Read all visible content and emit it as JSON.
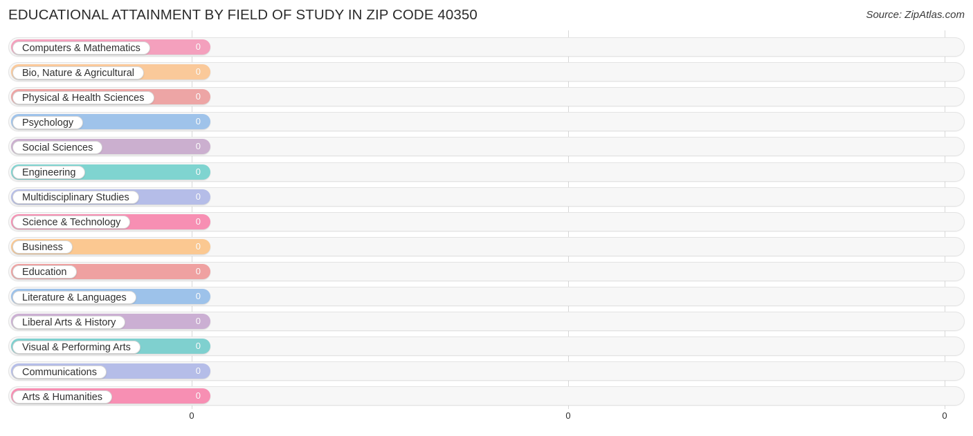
{
  "header": {
    "title": "EDUCATIONAL ATTAINMENT BY FIELD OF STUDY IN ZIP CODE 40350",
    "source": "Source: ZipAtlas.com"
  },
  "chart_data": {
    "type": "bar",
    "orientation": "horizontal",
    "title": "EDUCATIONAL ATTAINMENT BY FIELD OF STUDY IN ZIP CODE 40350",
    "xlabel": "",
    "ylabel": "",
    "xlim": [
      0,
      0
    ],
    "grid": true,
    "legend": "none",
    "xticks": [
      "0",
      "0",
      "0"
    ],
    "categories": [
      "Computers & Mathematics",
      "Bio, Nature & Agricultural",
      "Physical & Health Sciences",
      "Psychology",
      "Social Sciences",
      "Engineering",
      "Multidisciplinary Studies",
      "Science & Technology",
      "Business",
      "Education",
      "Literature & Languages",
      "Liberal Arts & History",
      "Visual & Performing Arts",
      "Communications",
      "Arts & Humanities"
    ],
    "values": [
      0,
      0,
      0,
      0,
      0,
      0,
      0,
      0,
      0,
      0,
      0,
      0,
      0,
      0,
      0
    ],
    "value_labels": [
      "0",
      "0",
      "0",
      "0",
      "0",
      "0",
      "0",
      "0",
      "0",
      "0",
      "0",
      "0",
      "0",
      "0",
      "0"
    ],
    "colors": [
      "#f4a0bd",
      "#fac99a",
      "#eda5a5",
      "#9fc3ea",
      "#cbafcf",
      "#7fd4d0",
      "#b5bde8",
      "#f78fb3",
      "#fbc891",
      "#efa1a1",
      "#9dc2ea",
      "#cbafd3",
      "#7fd0cf",
      "#b5bde8",
      "#f78fb3"
    ]
  }
}
